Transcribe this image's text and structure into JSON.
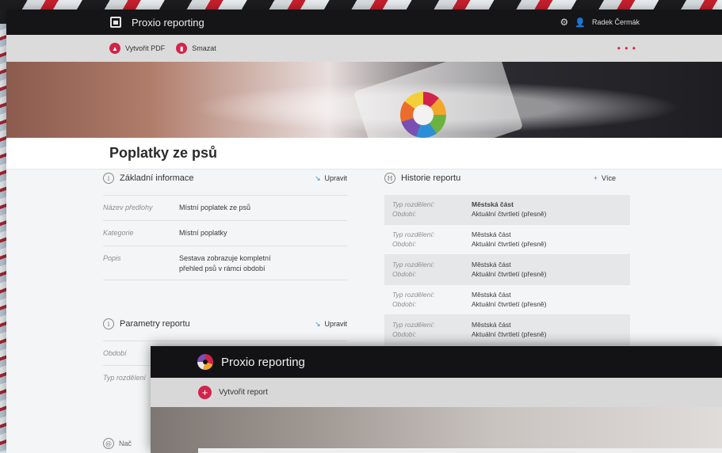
{
  "app": {
    "title": "Proxio reporting"
  },
  "topbar": {
    "user_name": "Radek Čermák"
  },
  "toolbar": {
    "create_pdf_label": "Vytvořit PDF",
    "delete_label": "Smazat",
    "more_label": "• • •"
  },
  "page": {
    "title": "Poplatky ze psů"
  },
  "basic_info": {
    "title": "Základní informace",
    "edit_label": "Upravit",
    "rows": [
      {
        "label": "Název předlohy",
        "value": "Místní poplatek ze psů"
      },
      {
        "label": "Kategorie",
        "value": "Místní poplatky"
      },
      {
        "label": "Popis",
        "value": "Sestava zobrazuje kompletní přehled psů v rámci období"
      }
    ]
  },
  "params": {
    "title": "Parametry reportu",
    "edit_label": "Upravit",
    "rows": [
      {
        "label": "Období"
      },
      {
        "label": "Typ rozdělení"
      }
    ]
  },
  "history": {
    "title": "Historie reportu",
    "more_label": "Více",
    "rows": [
      {
        "label1": "Typ rozdělení:",
        "value1": "Městská část",
        "label2": "Období:",
        "value2": "Aktuální čtvrtletí (přesně)"
      },
      {
        "label1": "Typ rozdělení:",
        "value1": "Městská část",
        "label2": "Období:",
        "value2": "Aktuální čtvrtletí (přesně)"
      },
      {
        "label1": "Typ rozdělení:",
        "value1": "Městská část",
        "label2": "Období:",
        "value2": "Aktuální čtvrtletí (přesně)"
      },
      {
        "label1": "Typ rozdělení:",
        "value1": "Městská část",
        "label2": "Období:",
        "value2": "Aktuální čtvrtletí (přesně)"
      },
      {
        "label1": "Typ rozdělení:",
        "value1": "Městská část",
        "label2": "Období:",
        "value2": "Aktuální čtvrtletí (přesně)"
      }
    ]
  },
  "next_section": {
    "label": "Nač"
  },
  "overlay": {
    "title": "Proxio reporting",
    "create_report_label": "Vytvořit report"
  },
  "icons": {
    "gear": "gear-icon",
    "user": "user-icon",
    "pdf": "pdf-icon",
    "delete": "delete-icon",
    "info": "info-icon",
    "history": "history-icon",
    "edit": "edit-icon",
    "plus": "plus-icon"
  },
  "colors": {
    "accent": "#d2244a",
    "topbar": "#151517",
    "link_icon": "#2c8fd6"
  }
}
